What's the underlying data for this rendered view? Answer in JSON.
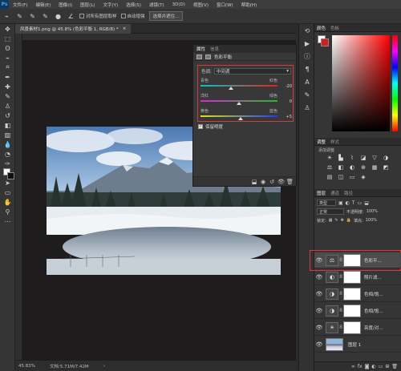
{
  "menubar": {
    "logo": "Ps",
    "items": [
      "文件(F)",
      "编辑(E)",
      "图像(I)",
      "图层(L)",
      "文字(Y)",
      "选择(S)",
      "滤镜(T)",
      "3D(D)",
      "视图(V)",
      "窗口(W)",
      "帮助(H)"
    ]
  },
  "options": {
    "sample_all": "对所有图层取样",
    "auto_enhance": "自动增强",
    "select_subject": "选择并遮住..."
  },
  "document": {
    "tab_title": "风景素材1.png @ 45.8% (色彩平衡 1, RGB/8) *",
    "zoom": "45.83%",
    "doc_info": "文档:5.71M/7.42M"
  },
  "properties": {
    "tab_active": "属性",
    "tab_other": "信息",
    "title": "色彩平衡",
    "tone_label": "色调:",
    "tone_value": "中间调",
    "sliders": [
      {
        "left": "青色",
        "right": "红色",
        "value": "-20",
        "pos": 0.4,
        "colors": [
          "#00c8c8",
          "#e02020"
        ]
      },
      {
        "left": "洋红",
        "right": "绿色",
        "value": "0",
        "pos": 0.5,
        "colors": [
          "#e020e0",
          "#20c020"
        ]
      },
      {
        "left": "黄色",
        "right": "蓝色",
        "value": "+5",
        "pos": 0.525,
        "colors": [
          "#e0e020",
          "#2040e0"
        ]
      }
    ],
    "preserve_label": "保留明度",
    "preserve_checked": "✓"
  },
  "color_panel": {
    "tab_active": "颜色",
    "tab_other": "色板"
  },
  "adjust_panel": {
    "tab_active": "调整",
    "tab_other": "样式",
    "label": "添加调整"
  },
  "layers_panel": {
    "tab_active": "图层",
    "tab_channels": "通道",
    "tab_paths": "路径",
    "kind": "类型",
    "blend_mode": "正常",
    "opacity_label": "不透明度:",
    "opacity_value": "100%",
    "lock_label": "锁定:",
    "fill_label": "填充:",
    "fill_value": "100%",
    "layers": [
      {
        "name": "色彩平...",
        "icon": "⚖",
        "selected": true
      },
      {
        "name": "照片滤...",
        "icon": "◐",
        "selected": false
      },
      {
        "name": "色相/饱...",
        "icon": "◑",
        "selected": false
      },
      {
        "name": "色相/饱...",
        "icon": "◑",
        "selected": false
      },
      {
        "name": "亮度/对...",
        "icon": "☀",
        "selected": false
      },
      {
        "name": "图层 1",
        "icon": "",
        "selected": false
      }
    ]
  }
}
